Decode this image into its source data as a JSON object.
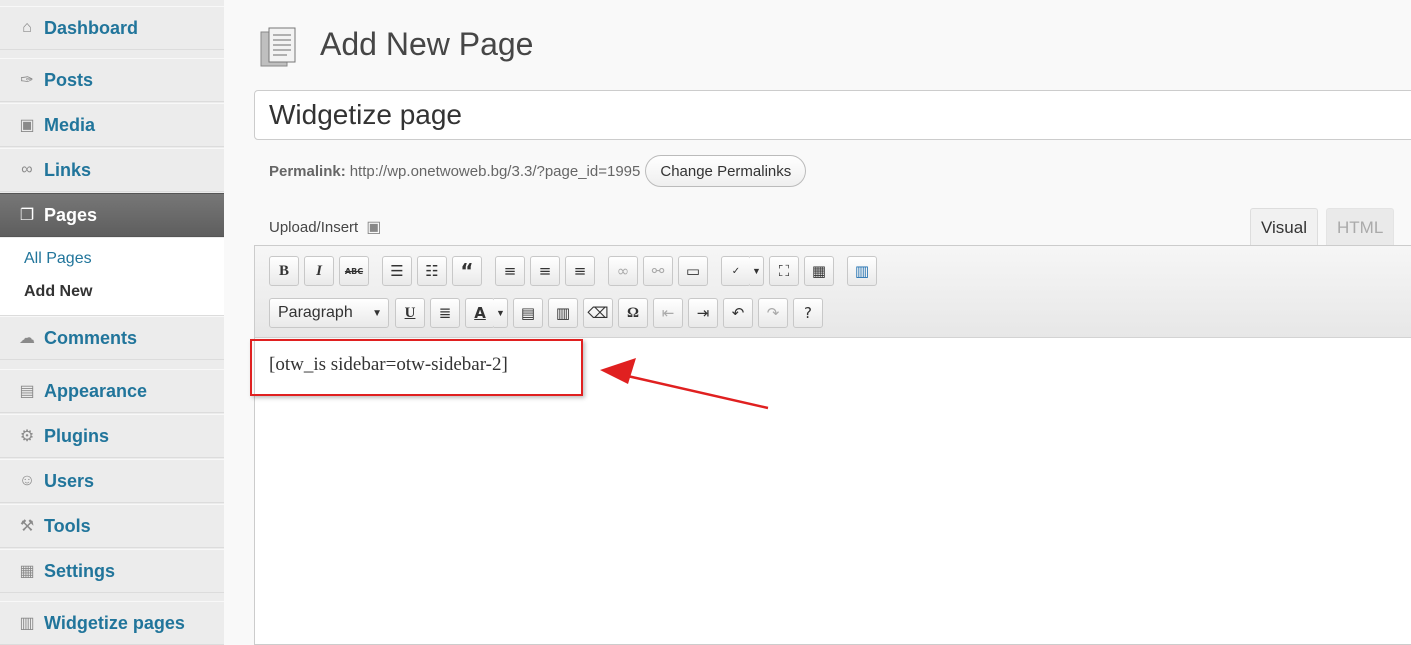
{
  "sidebar": {
    "items": [
      {
        "label": "Dashboard",
        "icon": "home-icon",
        "glyph": "⌂"
      },
      {
        "label": "Posts",
        "icon": "pushpin-icon",
        "glyph": "✑"
      },
      {
        "label": "Media",
        "icon": "media-icon",
        "glyph": "▣"
      },
      {
        "label": "Links",
        "icon": "link-icon",
        "glyph": "∞"
      },
      {
        "label": "Pages",
        "icon": "pages-icon",
        "glyph": "❐"
      },
      {
        "label": "Comments",
        "icon": "comment-icon",
        "glyph": "☁"
      },
      {
        "label": "Appearance",
        "icon": "appearance-icon",
        "glyph": "▤"
      },
      {
        "label": "Plugins",
        "icon": "plugin-icon",
        "glyph": "⚙"
      },
      {
        "label": "Users",
        "icon": "users-icon",
        "glyph": "☺"
      },
      {
        "label": "Tools",
        "icon": "tools-icon",
        "glyph": "⚒"
      },
      {
        "label": "Settings",
        "icon": "settings-icon",
        "glyph": "▦"
      },
      {
        "label": "Widgetize pages",
        "icon": "widgetize-icon",
        "glyph": "▥"
      }
    ],
    "submenu": {
      "all_pages": "All Pages",
      "add_new": "Add New"
    }
  },
  "main": {
    "title": "Add New Page",
    "title_field_value": "Widgetize page",
    "permalink": {
      "label": "Permalink:",
      "url": "http://wp.onetwoweb.bg/3.3/?page_id=1995",
      "button": "Change Permalinks"
    },
    "upload_insert": "Upload/Insert",
    "tabs": {
      "visual": "Visual",
      "html": "HTML"
    },
    "toolbar": {
      "format_value": "Paragraph",
      "bold": "B",
      "italic": "I",
      "strike": "ABC",
      "quote": "“",
      "underline": "U",
      "text_color": "A",
      "omega": "Ω"
    },
    "editor_content": "[otw_is sidebar=otw-sidebar-2]"
  },
  "colors": {
    "link": "#21759b",
    "active_menu": "#666666",
    "annotation": "#e02020"
  }
}
